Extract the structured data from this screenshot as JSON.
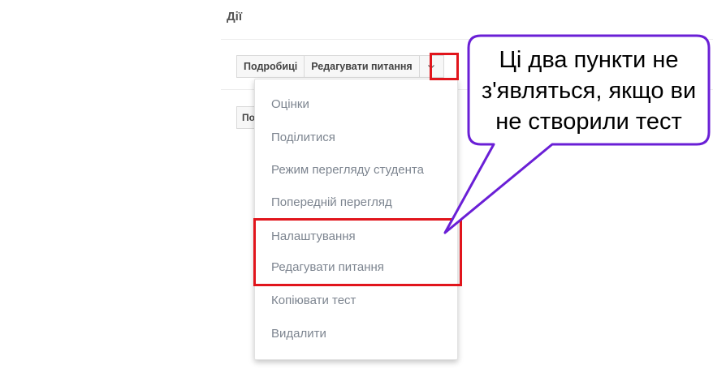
{
  "section": {
    "title": "Дії"
  },
  "buttons": {
    "details_label": "Подробиці",
    "edit_questions_label": "Редагувати питання",
    "toggle_icon": "chevron-down-icon",
    "partial_label": "По"
  },
  "dropdown": {
    "items": [
      {
        "label": "Оцінки"
      },
      {
        "label": "Поділитися"
      },
      {
        "label": "Режим перегляду студента"
      },
      {
        "label": "Попередній перегляд"
      },
      {
        "label": "Налаштування"
      },
      {
        "label": "Редагувати питання"
      },
      {
        "label": "Копіювати тест"
      },
      {
        "label": "Видалити"
      }
    ]
  },
  "annotation": {
    "lines": [
      "Ці два пункти не",
      "з'являться, якщо ви",
      "не створили тест"
    ],
    "highlight_color": "#e1151c",
    "callout_border_color": "#6a1fd6"
  }
}
